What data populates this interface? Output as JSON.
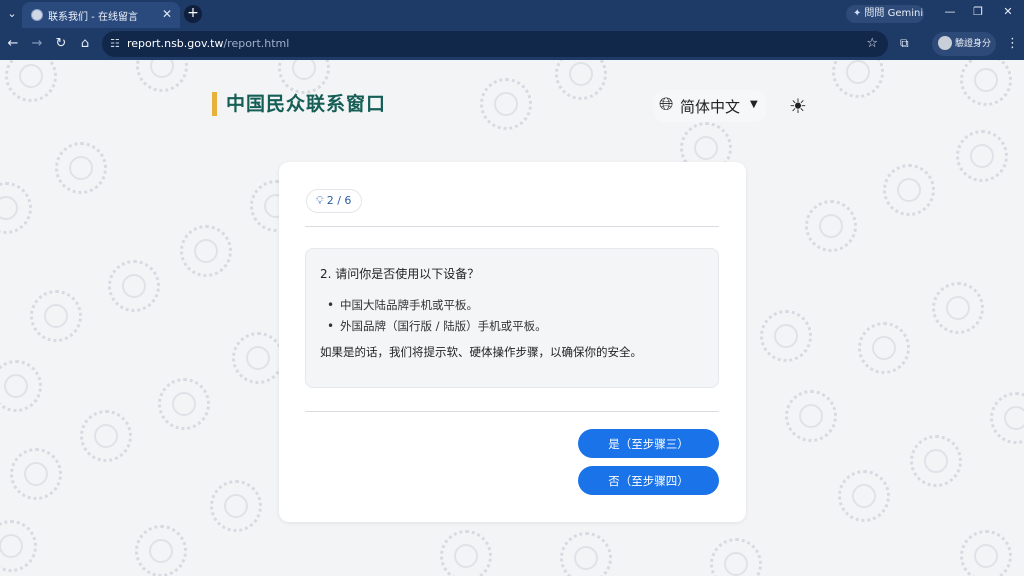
{
  "browser": {
    "tab_title": "联系我们 - 在线留言",
    "gemini_label": "問問 Gemini",
    "url_host": "report.nsb.gov.tw",
    "url_path": "/report.html",
    "profile_label": "驗證身分",
    "accent_color": "#1e3a66"
  },
  "page": {
    "site_title": "中国民众联系窗口",
    "language": "简体中文",
    "step_indicator": "2 / 6",
    "question": "2. 请问你是否使用以下设备？",
    "devices": [
      "中国大陆品牌手机或平板。",
      "外国品牌（国行版 / 陆版）手机或平板。"
    ],
    "note": "如果是的话，我们将提示软、硬体操作步骤，以确保你的安全。",
    "yes_button": "是（至步骤三）",
    "no_button": "否（至步骤四）",
    "title_color": "#145e55",
    "accent_bar_color": "#e8b13c",
    "button_color": "#1a73e8"
  }
}
